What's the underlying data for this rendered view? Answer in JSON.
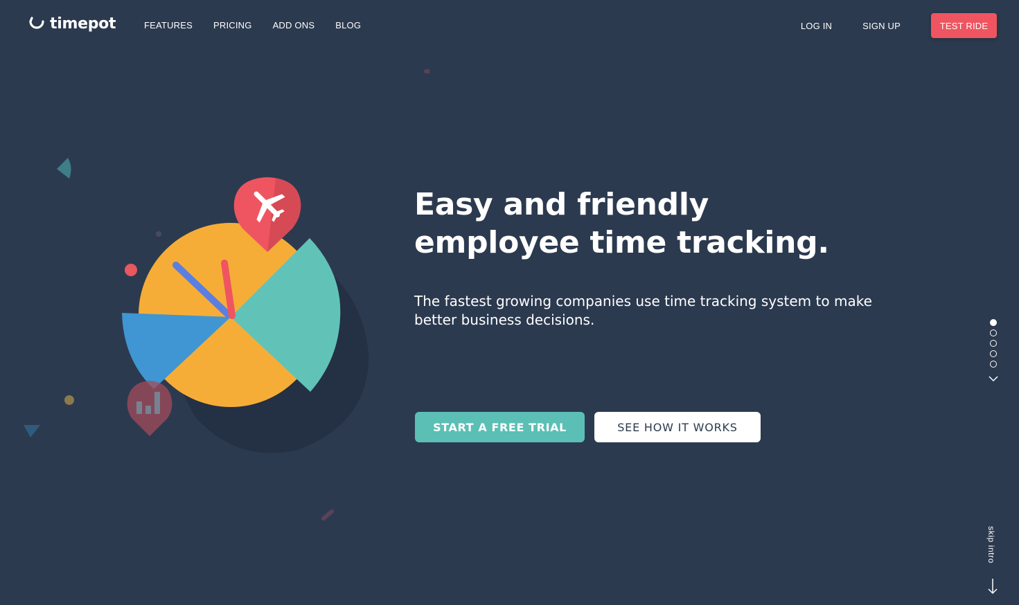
{
  "header": {
    "logo_text": "timepot",
    "nav_left": [
      "FEATURES",
      "PRICING",
      "ADD ONS",
      "BLOG"
    ],
    "login": "LOG IN",
    "signup": "SIGN UP",
    "test_ride": "TEST RIDE"
  },
  "hero": {
    "title_line1": "Easy and friendly",
    "title_line2": "employee time tracking.",
    "subtitle": "The fastest growing companies use time tracking system to make better business decisions.",
    "cta_primary": "START A FREE TRIAL",
    "cta_secondary": "SEE HOW IT WORKS"
  },
  "pager": {
    "total": 5,
    "active_index": 0
  },
  "skip_intro": "skip intro",
  "colors": {
    "background": "#2c3a4f",
    "accent_red": "#ef5560",
    "accent_teal": "#5bbfb5",
    "pie_orange": "#f6ad37",
    "pie_blue": "#3f96d2",
    "hand_blue": "#5b7fe0"
  },
  "icons": [
    "logo-smile-icon",
    "airplane-icon",
    "bar-chart-icon",
    "chevron-down-icon",
    "arrow-down-icon"
  ]
}
